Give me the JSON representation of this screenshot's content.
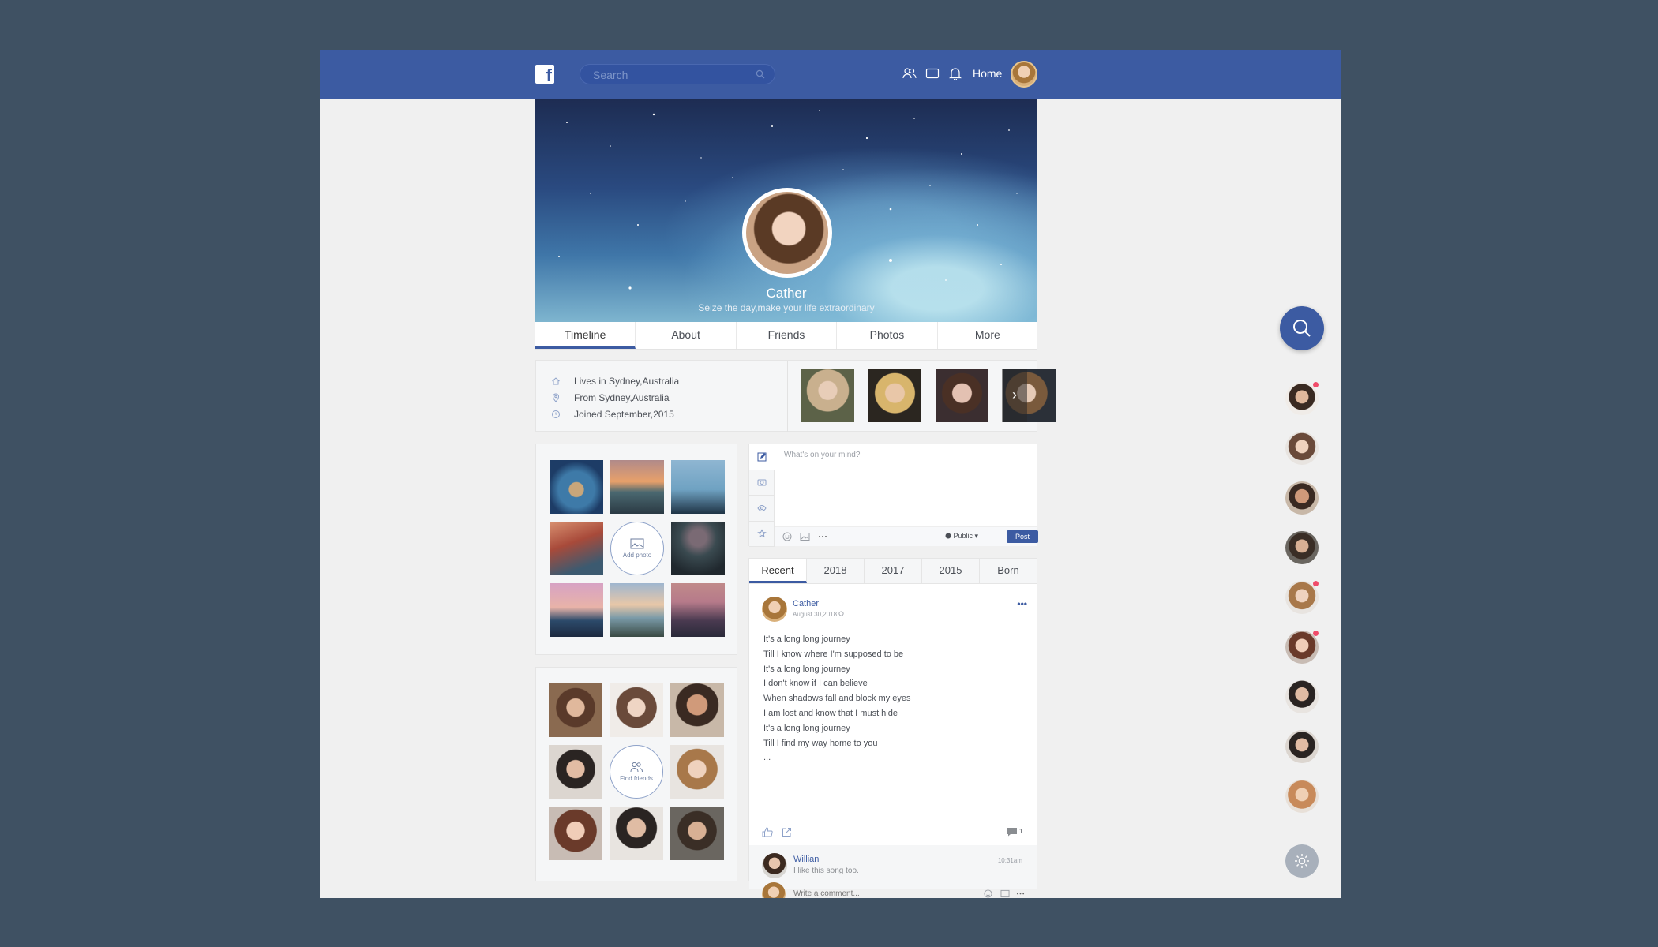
{
  "topbar": {
    "logo_letter": "f",
    "search_placeholder": "Search",
    "home_label": "Home"
  },
  "profile": {
    "name": "Cather",
    "tagline": "Seize the day,make your life extraordinary"
  },
  "tabs": [
    "Timeline",
    "About",
    "Friends",
    "Photos",
    "More"
  ],
  "active_tab": "Timeline",
  "info": {
    "lives": "Lives in Sydney,Australia",
    "from": "From Sydney,Australia",
    "joined": "Joined September,2015"
  },
  "photos": {
    "add_label": "Add photo"
  },
  "friends": {
    "find_label": "Find friends"
  },
  "composer": {
    "placeholder": "What's on your mind?",
    "privacy": "Public ▾",
    "post_label": "Post"
  },
  "feed_tabs": [
    "Recent",
    "2018",
    "2017",
    "2015",
    "Born"
  ],
  "post": {
    "author": "Cather",
    "date": "August 30,2018",
    "more": "•••",
    "lines": [
      "It's a long long journey",
      "Till I know where I'm supposed to be",
      "It's a long long journey",
      "I don't know if I can believe",
      "When shadows fall and block my eyes",
      "I am lost and know that I must hide",
      "It's a long long journey",
      "Till I find my way home to you",
      "..."
    ],
    "comment_count": "1"
  },
  "comment": {
    "author": "Willian",
    "text": "I like this song too.",
    "time": "10:31am"
  },
  "write_comment": {
    "placeholder": "Write a comment..."
  },
  "colors": {
    "brand": "#3c5ba2",
    "background": "#3f5163",
    "badge": "#f04c6a"
  }
}
